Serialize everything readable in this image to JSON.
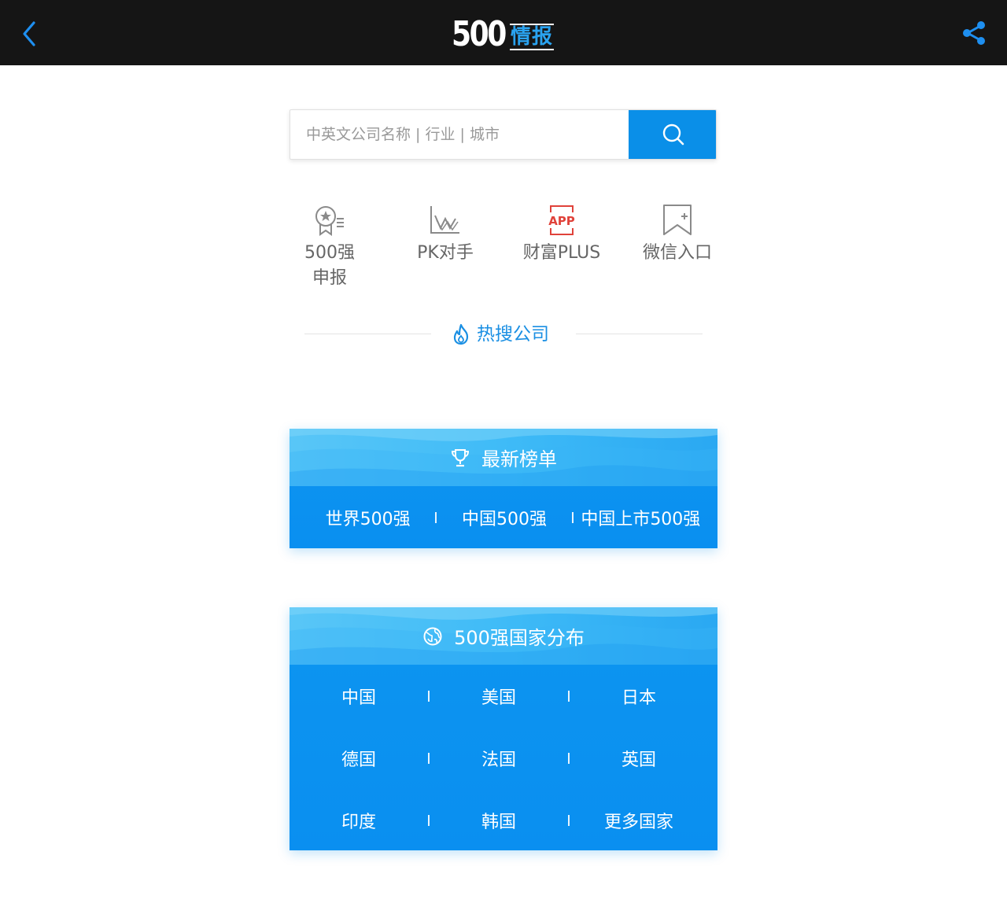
{
  "header": {
    "logo_number": "500",
    "logo_text": "情报",
    "back_icon": "chevron-left-icon",
    "share_icon": "share-icon",
    "accent": "#2aa3f0"
  },
  "search": {
    "placeholder": "中英文公司名称 | 行业 | 城市",
    "button_icon": "search-icon",
    "button_color": "#0a8fe8"
  },
  "shortcuts": [
    {
      "label": "500强申报",
      "icon": "award-badge-icon"
    },
    {
      "label": "PK对手",
      "icon": "chart-compare-icon"
    },
    {
      "label": "财富PLUS",
      "icon": "app-icon"
    },
    {
      "label": "微信入口",
      "icon": "bookmark-add-icon"
    }
  ],
  "hot": {
    "title": "热搜公司",
    "icon": "flame-icon"
  },
  "rankings": {
    "title": "最新榜单",
    "icon": "trophy-icon",
    "items": [
      "世界500强",
      "中国500强",
      "中国上市500强"
    ]
  },
  "countries": {
    "title": "500强国家分布",
    "icon": "globe-icon",
    "rows": [
      [
        "中国",
        "美国",
        "日本"
      ],
      [
        "德国",
        "法国",
        "英国"
      ],
      [
        "印度",
        "韩国",
        "更多国家"
      ]
    ]
  }
}
